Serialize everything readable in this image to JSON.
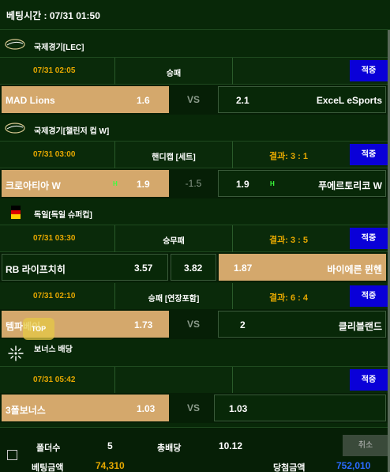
{
  "header": {
    "title": "베팅시간 : 07/31 01:50"
  },
  "apply_label": "적중",
  "vs_label": "VS",
  "h_mark": "H",
  "top_label": "TOP",
  "matches": [
    {
      "league": "국제경기[LEC]",
      "league_icon": "globe-icon",
      "time": "07/31 02:05",
      "type": "승패",
      "result": "",
      "home": {
        "name": "MAD Lions",
        "odds": "1.6",
        "selected": true
      },
      "middle": "VS",
      "away": {
        "name": "ExceL eSports",
        "odds": "2.1",
        "selected": false
      }
    },
    {
      "league": "국제경기[챌린저 컵 W]",
      "league_icon": "globe-icon",
      "time": "07/31 03:00",
      "type": "핸디캡 [세트]",
      "result": "결과: 3 : 1",
      "home": {
        "name": "크로아티아 W",
        "odds": "1.9",
        "selected": true
      },
      "middle": "-1.5",
      "away": {
        "name": "푸에르토리코 W",
        "odds": "1.9",
        "selected": false
      }
    },
    {
      "league": "독일[독일 슈퍼컵]",
      "league_icon": "germany-flag-icon",
      "time": "07/31 03:30",
      "type": "승무패",
      "result": "결과: 3 : 5",
      "home": {
        "name": "RB 라이프치히",
        "odds": "3.57",
        "selected": false
      },
      "draw_odds": "3.82",
      "away": {
        "name": "바이에른 뮌헨",
        "odds": "1.87",
        "selected": true
      }
    },
    {
      "league": "",
      "time": "07/31 02:10",
      "type": "승패 [연장포함]",
      "result": "결과: 6 : 4",
      "home": {
        "name": "템파베이",
        "odds": "1.73",
        "selected": true
      },
      "middle": "VS",
      "away": {
        "name": "클리블랜드",
        "odds": "2",
        "selected": false
      }
    },
    {
      "league": "보너스 배당",
      "league_icon": "sparkle-icon",
      "time": "07/31 05:42",
      "type": "",
      "result": "",
      "home": {
        "name": "3폴보너스",
        "odds": "1.03",
        "selected": true
      },
      "middle": "VS",
      "away": {
        "name": "",
        "odds": "1.03",
        "selected": false
      }
    }
  ],
  "footer": {
    "folder_label": "폴더수",
    "folder_value": "5",
    "total_odds_label": "총배당",
    "total_odds_value": "10.12",
    "cancel_label": "취소",
    "bet_amount_label": "베팅금액",
    "bet_amount_value": "74,310",
    "win_amount_label": "당첨금액",
    "win_amount_value": "752,010"
  },
  "colors": {
    "accent_orange": "#e6a800",
    "selected_bg": "#d4a86c",
    "apply_blue": "#0a00d8",
    "bg": "#082808"
  }
}
